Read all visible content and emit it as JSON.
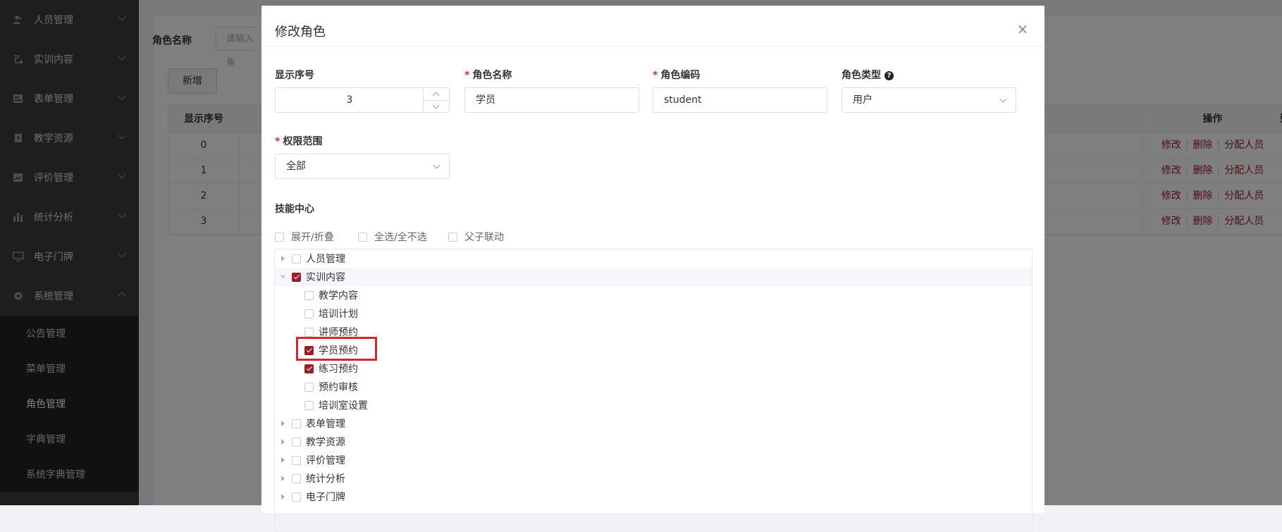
{
  "sidebar": {
    "items": [
      {
        "label": "人员管理",
        "icon": "users-icon",
        "expanded": false
      },
      {
        "label": "实训内容",
        "icon": "training-icon",
        "expanded": false
      },
      {
        "label": "表单管理",
        "icon": "form-icon",
        "expanded": false
      },
      {
        "label": "教学资源",
        "icon": "book-icon",
        "expanded": false
      },
      {
        "label": "评价管理",
        "icon": "evaluation-icon",
        "expanded": false
      },
      {
        "label": "统计分析",
        "icon": "bar-chart-icon",
        "expanded": false
      },
      {
        "label": "电子门牌",
        "icon": "monitor-icon",
        "expanded": false
      },
      {
        "label": "系统管理",
        "icon": "gear-icon",
        "expanded": true
      }
    ],
    "subitems": [
      {
        "label": "公告管理"
      },
      {
        "label": "菜单管理"
      },
      {
        "label": "角色管理",
        "active": true
      },
      {
        "label": "字典管理"
      },
      {
        "label": "系统字典管理"
      }
    ]
  },
  "search": {
    "label": "角色名称",
    "placeholder": "请输入角"
  },
  "add_button": "新增",
  "table": {
    "headers": {
      "seq": "显示序号",
      "partial": "型",
      "ops": "操作"
    },
    "rows": [
      {
        "seq": "0"
      },
      {
        "seq": "1"
      },
      {
        "seq": "2"
      },
      {
        "seq": "3"
      }
    ],
    "op_labels": {
      "edit": "修改",
      "delete": "删除",
      "assign": "分配人员"
    }
  },
  "dialog": {
    "title": "修改角色",
    "close_glyph": "×",
    "fields": {
      "seq_label": "显示序号",
      "seq_value": "3",
      "name_label": "角色名称",
      "name_value": "学员",
      "code_label": "角色编码",
      "code_value": "student",
      "type_label": "角色类型",
      "type_value": "用户",
      "help_glyph": "?",
      "scope_label": "权限范围",
      "scope_value": "全部",
      "required_mark": "*"
    },
    "skill_center": {
      "label": "技能中心",
      "options": [
        "展开/折叠",
        "全选/全不选",
        "父子联动"
      ],
      "tree": [
        {
          "label": "人员管理",
          "checked": false,
          "level": 0,
          "expandable": true
        },
        {
          "label": "实训内容",
          "checked": true,
          "level": 0,
          "expandable": true,
          "open": true
        },
        {
          "label": "教学内容",
          "checked": false,
          "level": 1
        },
        {
          "label": "培训计划",
          "checked": false,
          "level": 1
        },
        {
          "label": "讲师预约",
          "checked": false,
          "level": 1
        },
        {
          "label": "学员预约",
          "checked": true,
          "level": 1,
          "highlighted": true
        },
        {
          "label": "练习预约",
          "checked": true,
          "level": 1
        },
        {
          "label": "预约审核",
          "checked": false,
          "level": 1
        },
        {
          "label": "培训室设置",
          "checked": false,
          "level": 1
        },
        {
          "label": "表单管理",
          "checked": false,
          "level": 0,
          "expandable": true
        },
        {
          "label": "教学资源",
          "checked": false,
          "level": 0,
          "expandable": true
        },
        {
          "label": "评价管理",
          "checked": false,
          "level": 0,
          "expandable": true
        },
        {
          "label": "统计分析",
          "checked": false,
          "level": 0,
          "expandable": true
        },
        {
          "label": "电子门牌",
          "checked": false,
          "level": 0,
          "expandable": true
        }
      ]
    }
  },
  "colors": {
    "accent": "#9b1b2a",
    "sidebar_bg": "#3c3c3c",
    "highlight_border": "#d9232d"
  }
}
